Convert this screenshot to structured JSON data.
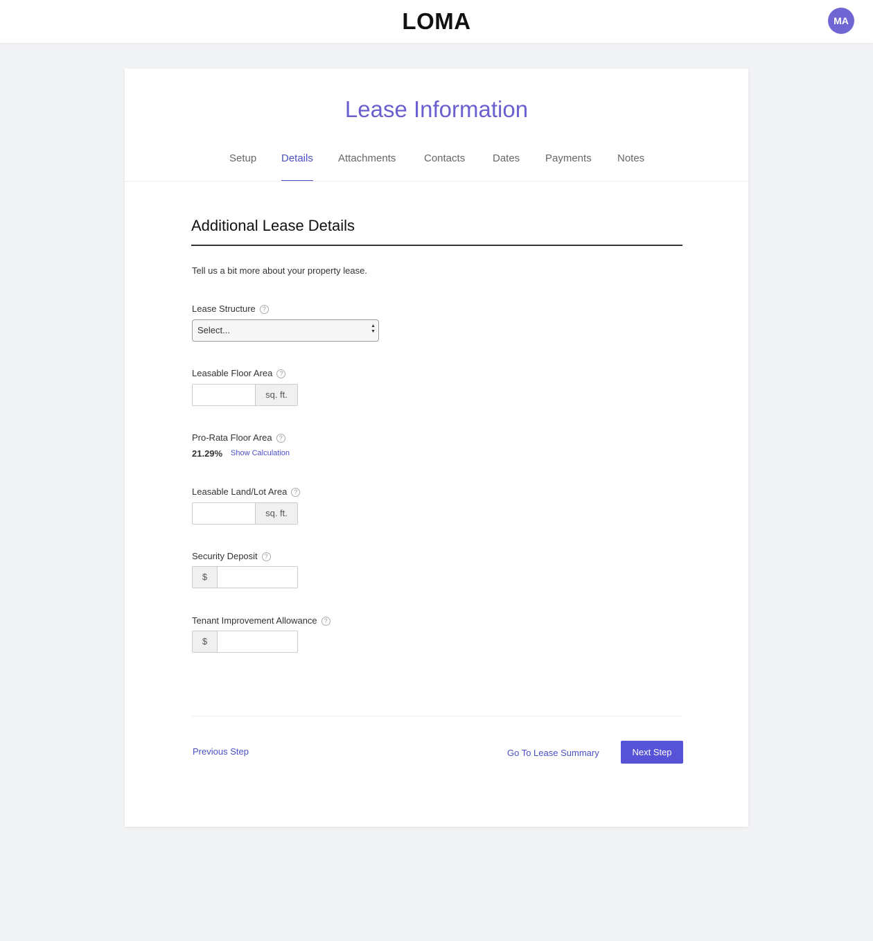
{
  "header": {
    "logo": "LOMA",
    "avatar_initials": "MA"
  },
  "page": {
    "title": "Lease Information",
    "tabs": [
      {
        "label": "Setup"
      },
      {
        "label": "Details"
      },
      {
        "label": "Attachments"
      },
      {
        "label": "Contacts"
      },
      {
        "label": "Dates"
      },
      {
        "label": "Payments"
      },
      {
        "label": "Notes"
      }
    ],
    "active_tab": "Details"
  },
  "section": {
    "title": "Additional Lease Details",
    "intro": "Tell us a bit more about your property lease."
  },
  "fields": {
    "lease_structure": {
      "label": "Lease Structure",
      "value": "Select..."
    },
    "leasable_floor_area": {
      "label": "Leasable Floor Area",
      "value": "",
      "unit": "sq. ft."
    },
    "pro_rata_floor_area": {
      "label": "Pro-Rata Floor Area",
      "value": "21.29%",
      "link": "Show Calculation"
    },
    "leasable_land_area": {
      "label": "Leasable Land/Lot Area",
      "value": "",
      "unit": "sq. ft."
    },
    "security_deposit": {
      "label": "Security Deposit",
      "prefix": "$",
      "value": ""
    },
    "tenant_improvement": {
      "label": "Tenant Improvement Allowance",
      "prefix": "$",
      "value": ""
    }
  },
  "help_glyph": "?",
  "footer": {
    "previous": "Previous Step",
    "summary": "Go To Lease Summary",
    "next": "Next Step"
  },
  "colors": {
    "accent": "#5753d6",
    "title": "#6b5fcf",
    "link": "#4b4fc5",
    "avatar": "#6f66d3",
    "background": "#f2f3f5"
  }
}
